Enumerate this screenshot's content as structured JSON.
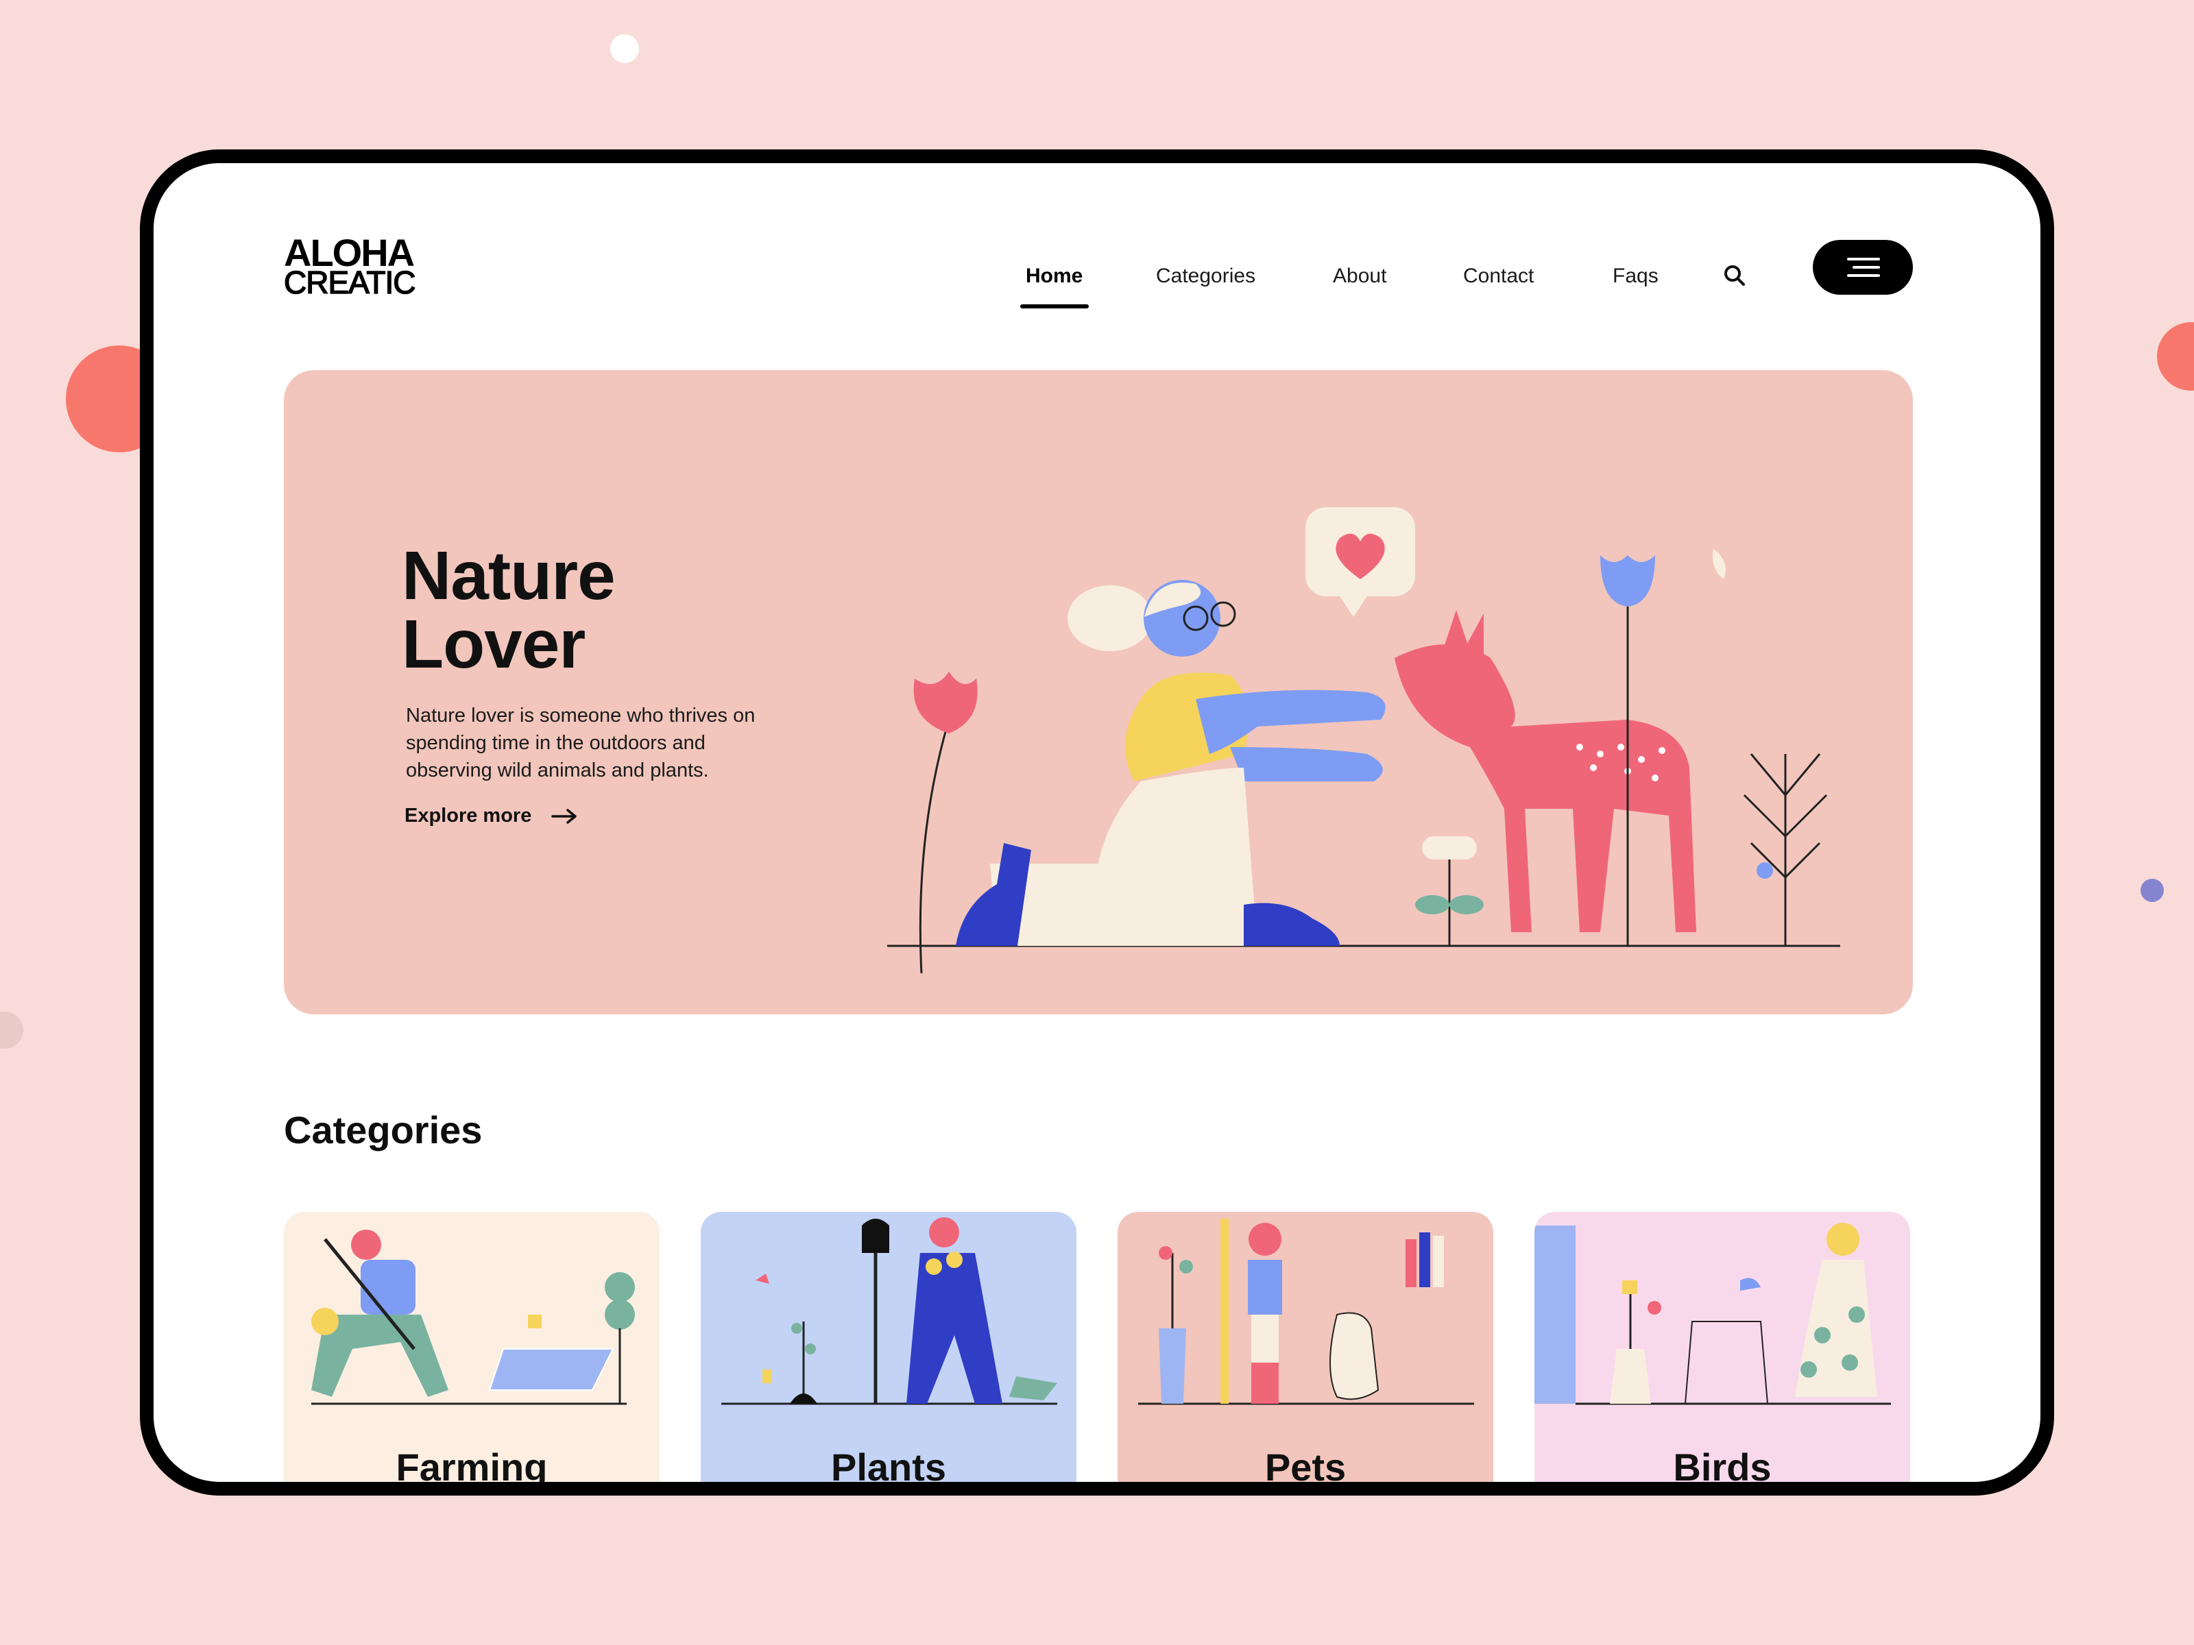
{
  "brand": {
    "line1": "ALOHA",
    "line2": "CREATIC"
  },
  "nav": {
    "items": [
      {
        "label": "Home",
        "active": true
      },
      {
        "label": "Categories",
        "active": false
      },
      {
        "label": "About",
        "active": false
      },
      {
        "label": "Contact",
        "active": false
      },
      {
        "label": "Faqs",
        "active": false
      }
    ],
    "search_icon": "search-icon",
    "menu_icon": "hamburger-menu-icon"
  },
  "hero": {
    "title_line1": "Nature",
    "title_line2": "Lover",
    "description": "Nature lover is someone who thrives on spending time in the outdoors and observing wild animals and plants.",
    "cta_label": "Explore more",
    "cta_icon": "arrow-right-icon",
    "background": "#f2c6bc"
  },
  "categories": {
    "heading": "Categories",
    "items": [
      {
        "label": "Farming",
        "background": "#fcefe2"
      },
      {
        "label": "Plants",
        "background": "#c3d3f6"
      },
      {
        "label": "Pets",
        "background": "#f2c6bc"
      },
      {
        "label": "Birds",
        "background": "#f8d9ec"
      }
    ]
  },
  "colors": {
    "page_background": "#f9dcd9",
    "accent_coral": "#f8776c",
    "accent_blue": "#2f3ec5",
    "accent_pink": "#f06679"
  }
}
